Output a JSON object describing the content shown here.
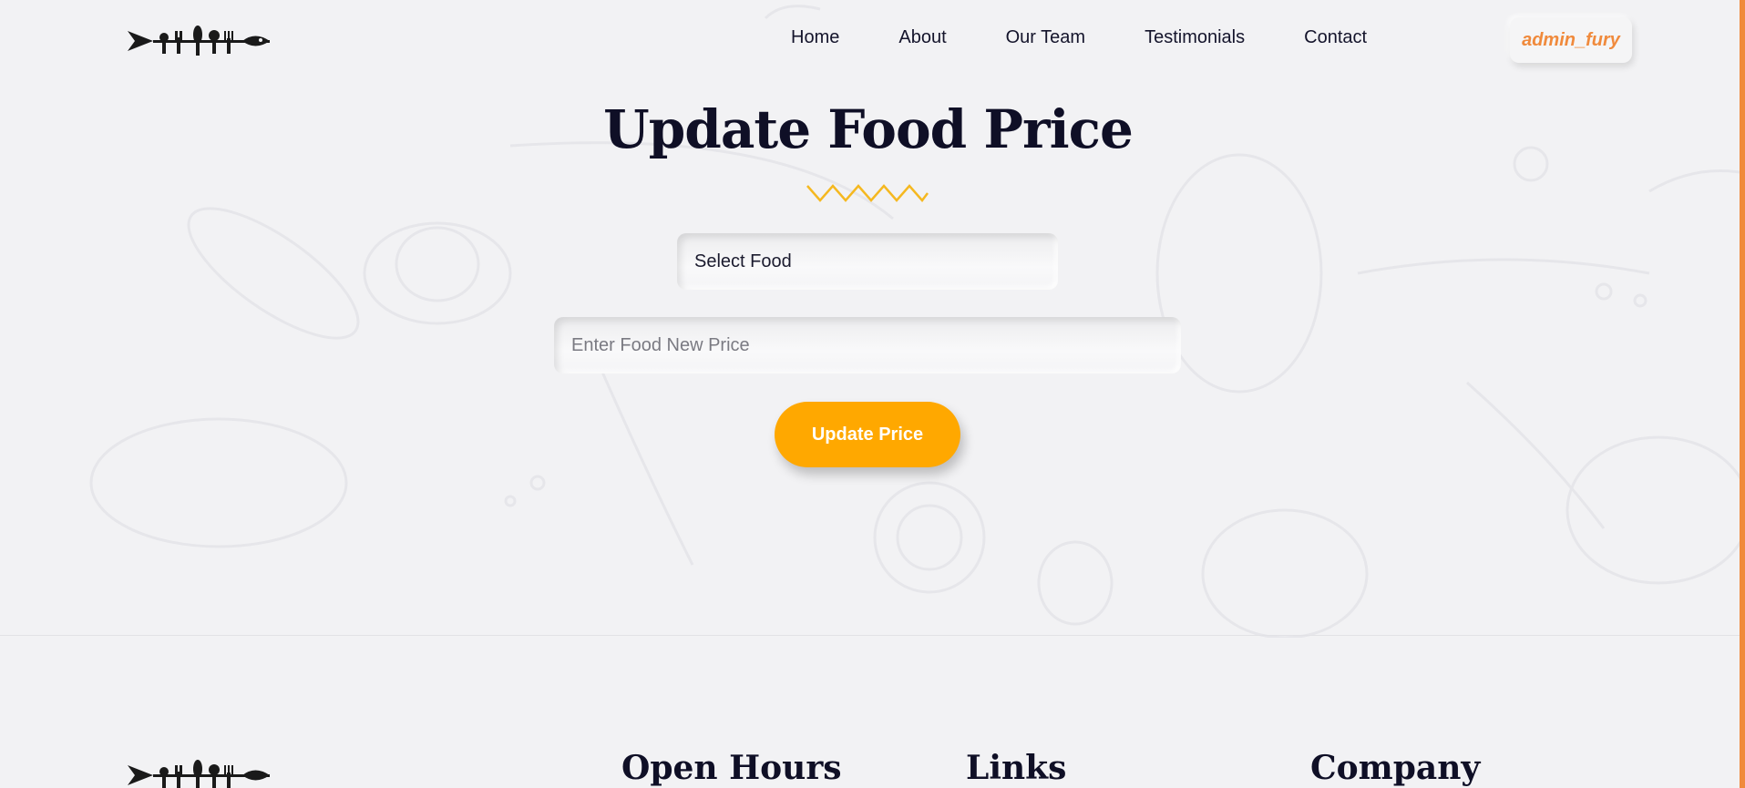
{
  "header": {
    "nav": [
      {
        "label": "Home"
      },
      {
        "label": "About"
      },
      {
        "label": "Our Team"
      },
      {
        "label": "Testimonials"
      },
      {
        "label": "Contact"
      }
    ],
    "user": "admin_fury"
  },
  "main": {
    "title": "Update Food Price",
    "select_value": "Select Food",
    "price_placeholder": "Enter Food New Price",
    "button_label": "Update Price"
  },
  "footer": {
    "headings": [
      "Open Hours",
      "Links",
      "Company"
    ]
  },
  "colors": {
    "accent": "#f08a3c",
    "button": "#ffa800",
    "zigzag": "#f5b820",
    "title": "#0f0f26"
  },
  "icons": {
    "logo": "cutlery-fish-logo-icon",
    "divider": "zigzag-divider-icon"
  }
}
